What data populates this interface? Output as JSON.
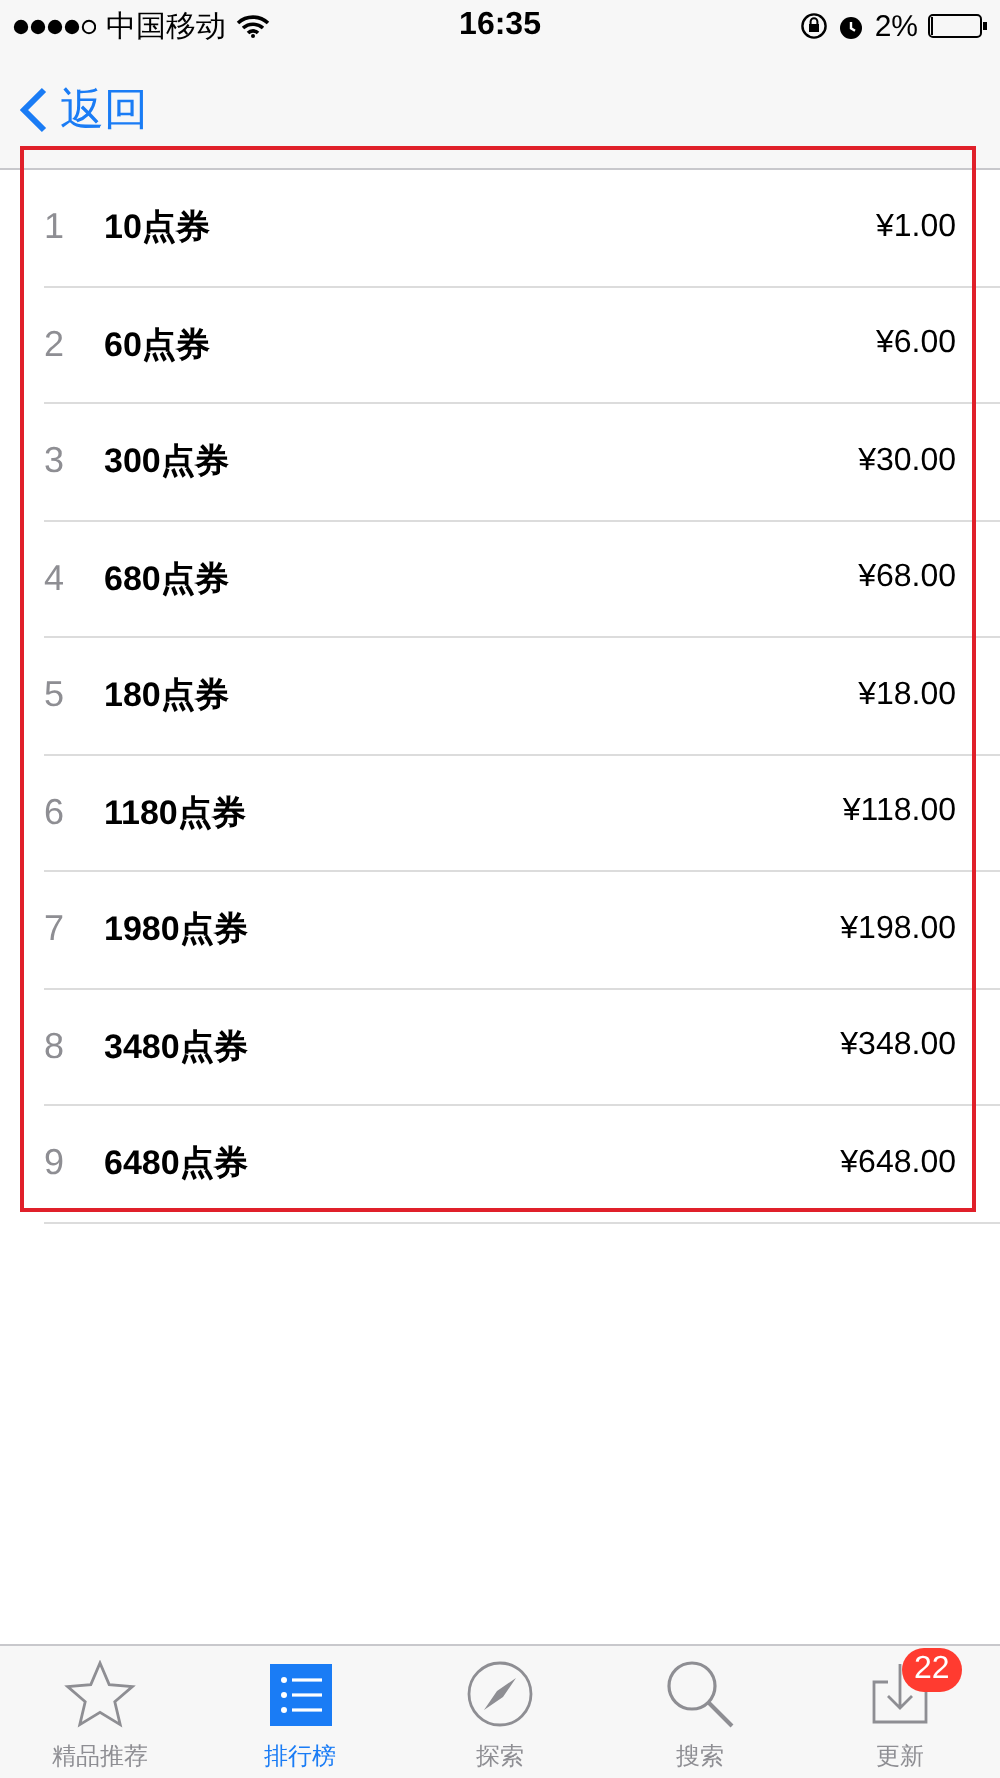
{
  "status_bar": {
    "carrier": "中国移动",
    "time": "16:35",
    "battery": "2%"
  },
  "nav_bar": {
    "back": "返回"
  },
  "highlight_frame": true,
  "list": [
    {
      "rank": "1",
      "name": "10点券",
      "price": "¥1.00"
    },
    {
      "rank": "2",
      "name": "60点券",
      "price": "¥6.00"
    },
    {
      "rank": "3",
      "name": "300点券",
      "price": "¥30.00"
    },
    {
      "rank": "4",
      "name": "680点券",
      "price": "¥68.00"
    },
    {
      "rank": "5",
      "name": "180点券",
      "price": "¥18.00"
    },
    {
      "rank": "6",
      "name": "1180点券",
      "price": "¥118.00"
    },
    {
      "rank": "7",
      "name": "1980点券",
      "price": "¥198.00"
    },
    {
      "rank": "8",
      "name": "3480点券",
      "price": "¥348.00"
    },
    {
      "rank": "9",
      "name": "6480点券",
      "price": "¥648.00"
    }
  ],
  "tab_bar": [
    {
      "kind": "star",
      "label": "精品推荐",
      "selected": false
    },
    {
      "kind": "list",
      "label": "排行榜",
      "selected": true
    },
    {
      "kind": "compass",
      "label": "探索",
      "selected": false
    },
    {
      "kind": "search",
      "label": "搜索",
      "selected": false
    },
    {
      "kind": "download",
      "label": "更新",
      "selected": false,
      "badge": "22"
    }
  ]
}
